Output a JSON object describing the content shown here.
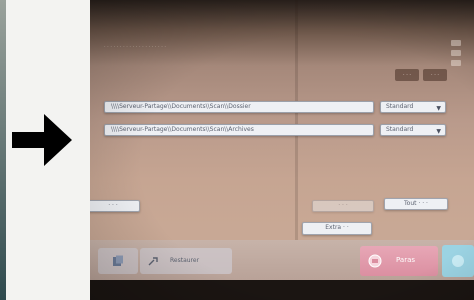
{
  "screen": {
    "header_text": "· · · · · · · ·  · · · · · ·  · · · · · ·",
    "corner_buttons": [
      "· · ·",
      "· · ·"
    ]
  },
  "rows": [
    {
      "path": "\\\\\\\\Serveur-Partage\\\\Documents\\\\Scan\\\\Dossier",
      "option": "Standard"
    },
    {
      "path": "\\\\\\\\Serveur-Partage\\\\Documents\\\\Scan\\\\Archives",
      "option": "Standard"
    }
  ],
  "buttons": {
    "bottom_left_partial": "· · ·",
    "middle_disabled": "· · ·",
    "select_all": "Tout · · ·",
    "extra": "Extra · ·"
  },
  "bottom_bar": {
    "reset_label": "Restaurer",
    "print_label": "Paras"
  },
  "colors": {
    "arrow": "#000000",
    "print_button": "#db8fa1",
    "start_button": "#9bd3e3"
  }
}
